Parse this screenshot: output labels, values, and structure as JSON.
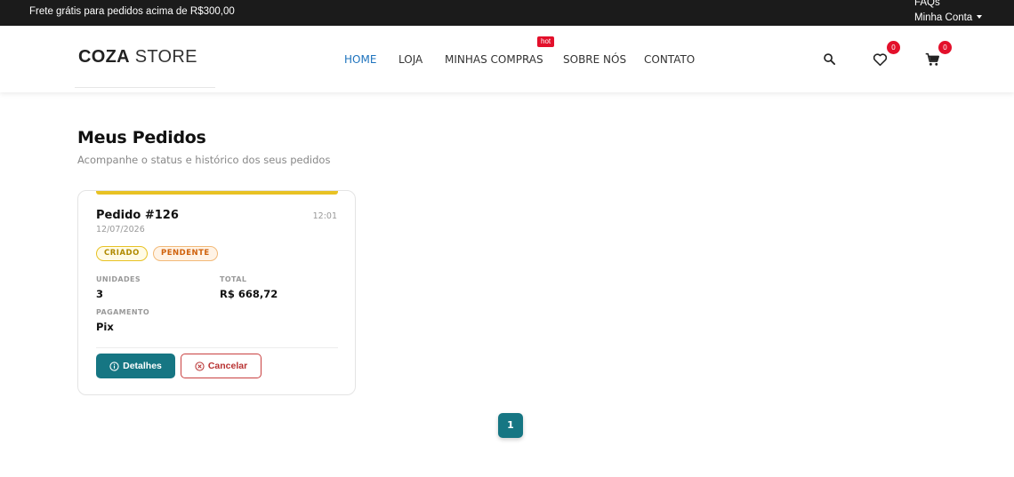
{
  "topbar": {
    "promo": "Frete grátis para pedidos acima de R$300,00",
    "faqs": "FAQs",
    "account": "Minha Conta"
  },
  "header": {
    "logo_bold": "COZA",
    "logo_rest": " STORE",
    "nav": [
      {
        "label": "HOME",
        "active": true
      },
      {
        "label": "LOJA",
        "active": false
      },
      {
        "label": "MINHAS COMPRAS",
        "active": false
      },
      {
        "label": "SOBRE NÓS",
        "active": false
      },
      {
        "label": "CONTATO",
        "active": false
      }
    ],
    "hot_badge": "hot",
    "wishlist_count": "0",
    "cart_count": "0",
    "icons": [
      "search-icon",
      "heart-icon",
      "cart-icon"
    ]
  },
  "page": {
    "title": "Meus Pedidos",
    "subtitle": "Acompanhe o status e histórico dos seus pedidos"
  },
  "order": {
    "title": "Pedido #126",
    "date": "12/07/2026",
    "time": "12:01",
    "status_tags": [
      "CRIADO",
      "PENDENTE"
    ],
    "units_label": "UNIDADES",
    "units_value": "3",
    "total_label": "TOTAL",
    "total_value": "R$ 668,72",
    "payment_label": "PAGAMENTO",
    "payment_value": "Pix",
    "details_button": "Detalhes",
    "cancel_button": "Cancelar"
  },
  "pagination": {
    "current_page": "1"
  },
  "colors": {
    "accent": "#167683",
    "nav_active": "#1e73be",
    "badge": "#e3102b",
    "status_criado": "#e8c224",
    "status_pendente": "#d0620c",
    "cancel": "#c94040"
  }
}
